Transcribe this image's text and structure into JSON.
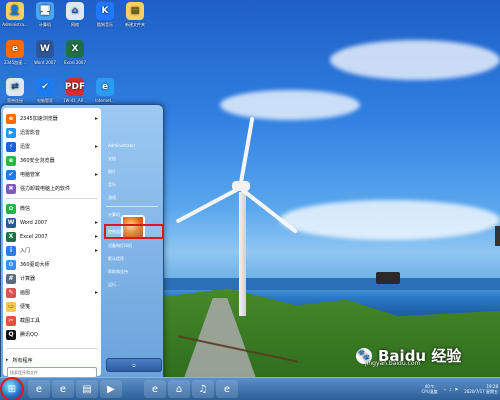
{
  "desktop": {
    "icons": [
      {
        "label": "Administra..."
      },
      {
        "label": "计算机"
      },
      {
        "label": "网络"
      },
      {
        "label": "酷狗音乐"
      },
      {
        "label": "新建文件夹"
      },
      {
        "label": "2345加速..."
      },
      {
        "label": "Word 2007"
      },
      {
        "label": "Excel 2007"
      },
      {
        "label": "宽带连接"
      },
      {
        "label": "电脑管家"
      },
      {
        "label": "1W-41_AR..."
      },
      {
        "label": "Internet..."
      }
    ]
  },
  "start_menu": {
    "pinned": [
      {
        "label": "2345加速浏览器",
        "icon": "browser-icon",
        "has_arrow": true
      },
      {
        "label": "迅雷影音",
        "icon": "video-icon",
        "has_arrow": false
      },
      {
        "label": "迅雷",
        "icon": "thunder-icon",
        "has_arrow": true
      },
      {
        "label": "360安全浏览器",
        "icon": "360-browser-icon",
        "has_arrow": false
      },
      {
        "label": "电脑管家",
        "icon": "shield-icon",
        "has_arrow": true
      },
      {
        "label": "强力卸载电脑上的软件",
        "icon": "uninstall-icon",
        "has_arrow": false
      },
      {
        "label": "微信",
        "icon": "wechat-icon",
        "has_arrow": false
      },
      {
        "label": "Word 2007",
        "icon": "word-icon",
        "has_arrow": true
      },
      {
        "label": "Excel 2007",
        "icon": "excel-icon",
        "has_arrow": true
      },
      {
        "label": "入门",
        "icon": "getting-started-icon",
        "has_arrow": true
      },
      {
        "label": "360驱动大师",
        "icon": "driver-icon",
        "has_arrow": false
      },
      {
        "label": "计算器",
        "icon": "calculator-icon",
        "has_arrow": false
      },
      {
        "label": "画图",
        "icon": "paint-icon",
        "has_arrow": true
      },
      {
        "label": "便笺",
        "icon": "sticky-notes-icon",
        "has_arrow": false
      },
      {
        "label": "截图工具",
        "icon": "snipping-icon",
        "has_arrow": false
      },
      {
        "label": "腾讯QQ",
        "icon": "qq-icon",
        "has_arrow": false
      }
    ],
    "all_programs_label": "所有程序",
    "search_placeholder": "搜索程序和文件",
    "right_items": [
      {
        "label": "Administrator"
      },
      {
        "label": "文档"
      },
      {
        "label": "图片"
      },
      {
        "label": "音乐"
      },
      {
        "label": "游戏"
      },
      {
        "label": "计算机"
      },
      {
        "label": "控制面板",
        "highlight": true
      },
      {
        "label": "设备和打印机"
      },
      {
        "label": "默认程序"
      },
      {
        "label": "帮助和支持"
      },
      {
        "label": "运行..."
      }
    ]
  },
  "taskbar": {
    "buttons": [
      {
        "icon": "ie-icon"
      },
      {
        "icon": "ie-icon-2"
      },
      {
        "icon": "folder-icon"
      },
      {
        "icon": "media-player-icon"
      },
      {
        "icon": "browser-icon"
      },
      {
        "icon": "network-icon"
      },
      {
        "icon": "qqmusic-icon"
      },
      {
        "icon": "360-browser-icon"
      }
    ],
    "tray": {
      "temp_label": "40℃",
      "cpu_label": "CPU温度",
      "time": "19:28",
      "date": "2020/7/17 星期五"
    }
  },
  "watermark": {
    "text": "Baidu 经验",
    "url": "jingyan.baidu.com"
  }
}
